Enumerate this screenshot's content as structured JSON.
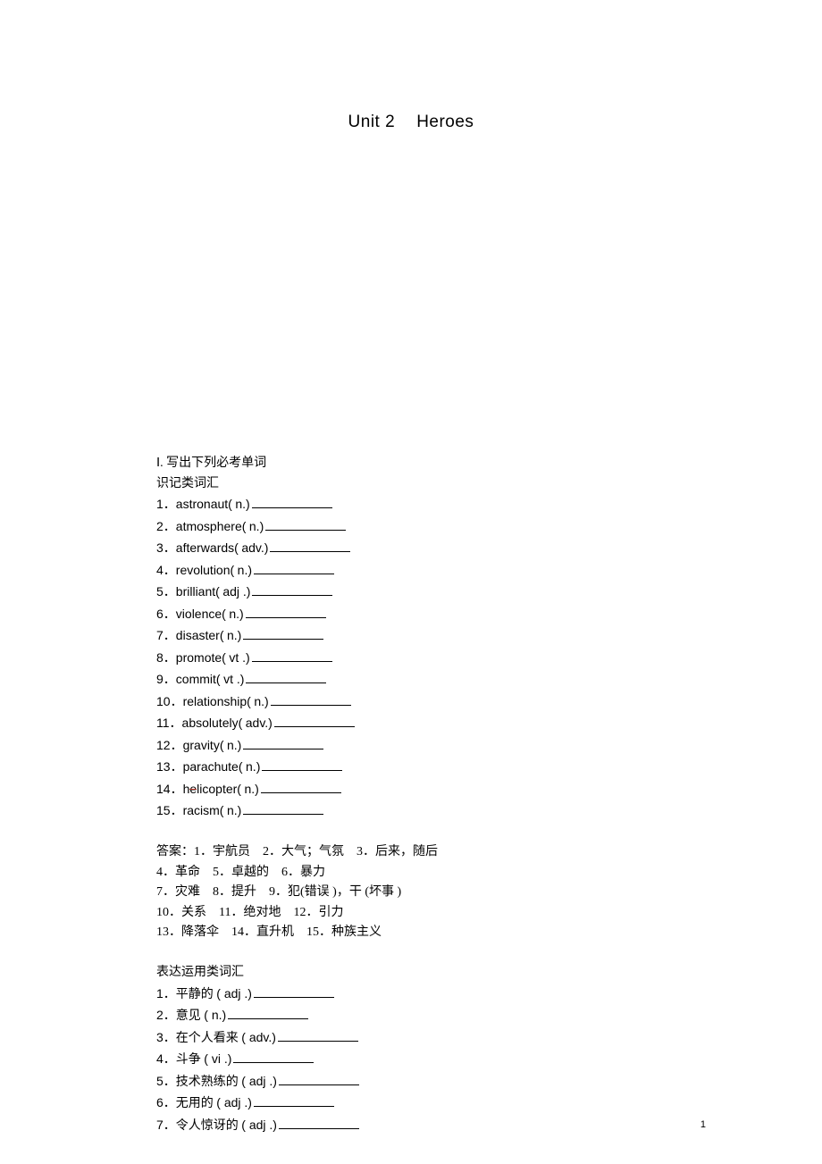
{
  "title": {
    "left": "Unit 2",
    "right": "Heroes"
  },
  "section1_header": "Ⅰ. 写出下列必考单词",
  "section1_sub": "识记类词汇",
  "vocab1": [
    {
      "num": "1．",
      "word": "astronaut(",
      "pos": "n.)"
    },
    {
      "num": "2．",
      "word": "atmosphere(",
      "pos": "n.)"
    },
    {
      "num": "3．",
      "word": "afterwards(",
      "pos": "adv.)"
    },
    {
      "num": "4．",
      "word": "revolution(",
      "pos": "n.)"
    },
    {
      "num": "5．",
      "word": "brilliant(",
      "pos": "adj .)"
    },
    {
      "num": "6．",
      "word": "violence(",
      "pos": "n.)"
    },
    {
      "num": "7．",
      "word": "disaster(",
      "pos": "n.)"
    },
    {
      "num": "8．",
      "word": "promote(",
      "pos": "vt .)"
    },
    {
      "num": "9．",
      "word": "commit(",
      "pos": "vt .)"
    },
    {
      "num": "10．",
      "word": "relationship(",
      "pos": "n.)"
    },
    {
      "num": "11．",
      "word": "absolutely(",
      "pos": "adv.)"
    },
    {
      "num": "12．",
      "word": "gravity(",
      "pos": "n.)"
    },
    {
      "num": "13．",
      "word": "parachute(",
      "pos": "n.)"
    },
    {
      "num": "14．",
      "word_pre": "h",
      "word_strike": "e",
      "word_post": "licopter(",
      "pos": "n.)"
    },
    {
      "num": "15．",
      "word": "racism(",
      "pos": "n.)"
    }
  ],
  "answers_label": "答案：",
  "answers": [
    "1．宇航员　2．大气；气氛　3．后来，随后",
    "4．革命　5．卓越的　6．暴力",
    "7．灾难　8．提升　9．犯(错误 )，干 (坏事 )",
    "10．关系　11．绝对地　12．引力",
    "13．降落伞　14．直升机　15．种族主义"
  ],
  "section2_sub": "表达运用类词汇",
  "vocab2": [
    {
      "num": "1．",
      "word": "平静的",
      "pos": "( adj .)"
    },
    {
      "num": "2．",
      "word": "意见",
      "pos": "( n.)"
    },
    {
      "num": "3．",
      "word": "在个人看来",
      "pos": "( adv.)"
    },
    {
      "num": "4．",
      "word": "斗争",
      "pos": "( vi .)"
    },
    {
      "num": "5．",
      "word": "技术熟练的",
      "pos": "( adj .)"
    },
    {
      "num": "6．",
      "word": "无用的",
      "pos": "( adj .)"
    },
    {
      "num": "7．",
      "word": "令人惊讶的",
      "pos": "( adj .)"
    }
  ],
  "page_number": "1"
}
